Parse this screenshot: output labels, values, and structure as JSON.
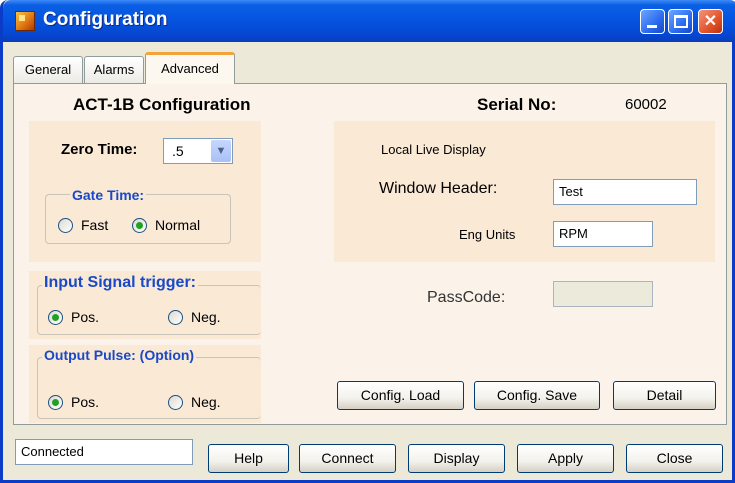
{
  "window": {
    "title": "Configuration"
  },
  "tabs": [
    {
      "label": "General"
    },
    {
      "label": "Alarms"
    },
    {
      "label": "Advanced"
    }
  ],
  "advanced": {
    "heading": "ACT-1B Configuration",
    "serial_label": "Serial No:",
    "serial_value": "60002",
    "zero_time": {
      "label": "Zero Time:",
      "value": ".5"
    },
    "gate_time": {
      "title": "Gate Time:",
      "options": [
        "Fast",
        "Normal"
      ],
      "selected": "Normal"
    },
    "input_trigger": {
      "title": "Input Signal trigger:",
      "options": [
        "Pos.",
        "Neg."
      ],
      "selected": "Pos."
    },
    "output_pulse": {
      "title": "Output Pulse: (Option)",
      "options": [
        "Pos.",
        "Neg."
      ],
      "selected": "Pos."
    },
    "live_display": {
      "title": "Local Live Display",
      "window_header_label": "Window Header:",
      "window_header_value": "Test",
      "eng_units_label": "Eng Units",
      "eng_units_value": "RPM"
    },
    "passcode": {
      "label": "PassCode:",
      "value": ""
    },
    "buttons": {
      "config_load": "Config. Load",
      "config_save": "Config. Save",
      "detail": "Detail"
    }
  },
  "footer": {
    "status": "Connected",
    "buttons": {
      "help": "Help",
      "connect": "Connect",
      "display": "Display",
      "apply": "Apply",
      "close": "Close"
    }
  },
  "colors": {
    "titlebar": "#0553e0",
    "group_title": "#1a49c8",
    "group_fill": "#f9e9d5",
    "radio_dot": "#21a121"
  }
}
